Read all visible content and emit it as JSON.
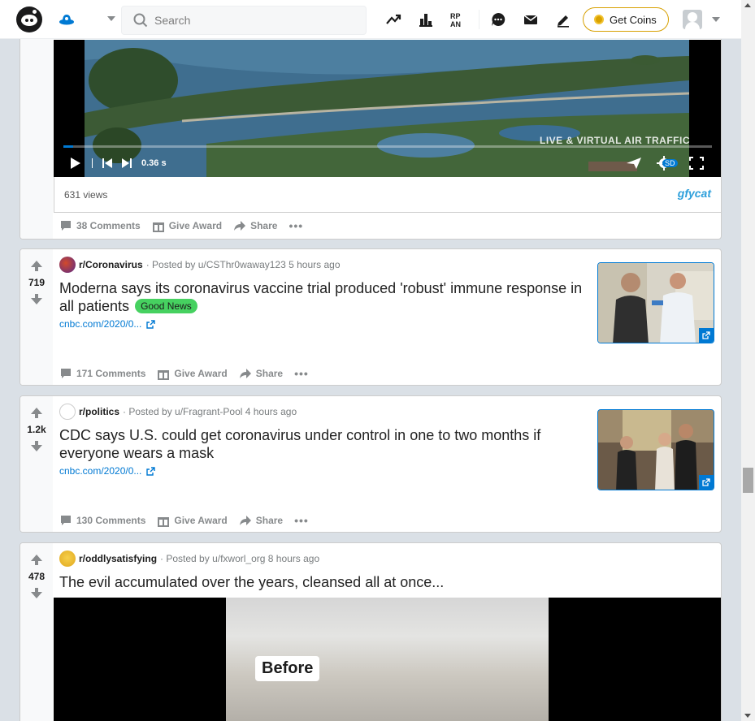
{
  "header": {
    "search_placeholder": "Search",
    "get_coins_label": "Get Coins"
  },
  "posts": [
    {
      "views": "631 views",
      "player_time": "0.36 s",
      "video_overlay": "LIVE & VIRTUAL AIR TRAFFIC",
      "quality_badge": "SD",
      "provider": "gfycat",
      "comments": "38 Comments",
      "give_award": "Give Award",
      "share": "Share"
    },
    {
      "votes": "719",
      "subreddit": "r/Coronavirus",
      "posted_by": "· Posted by u/CSThr0waway123 5 hours ago",
      "title": "Moderna says its coronavirus vaccine trial produced 'robust' immune response in all patients",
      "flair": "Good News",
      "link": "cnbc.com/2020/0...",
      "comments": "171 Comments",
      "give_award": "Give Award",
      "share": "Share"
    },
    {
      "votes": "1.2k",
      "subreddit": "r/politics",
      "posted_by": "· Posted by u/Fragrant-Pool 4 hours ago",
      "title": "CDC says U.S. could get coronavirus under control in one to two months if everyone wears a mask",
      "link": "cnbc.com/2020/0...",
      "comments": "130 Comments",
      "give_award": "Give Award",
      "share": "Share"
    },
    {
      "votes": "478",
      "subreddit": "r/oddlysatisfying",
      "posted_by": "· Posted by u/fxworl_org 8 hours ago",
      "title": "The evil accumulated over the years, cleansed all at once...",
      "video_caption": "Before"
    }
  ],
  "colors": {
    "accent": "#0079d3",
    "good_news_flair": "#46d160",
    "coins_border": "#d7a000",
    "page_bg": "#dae0e6"
  }
}
